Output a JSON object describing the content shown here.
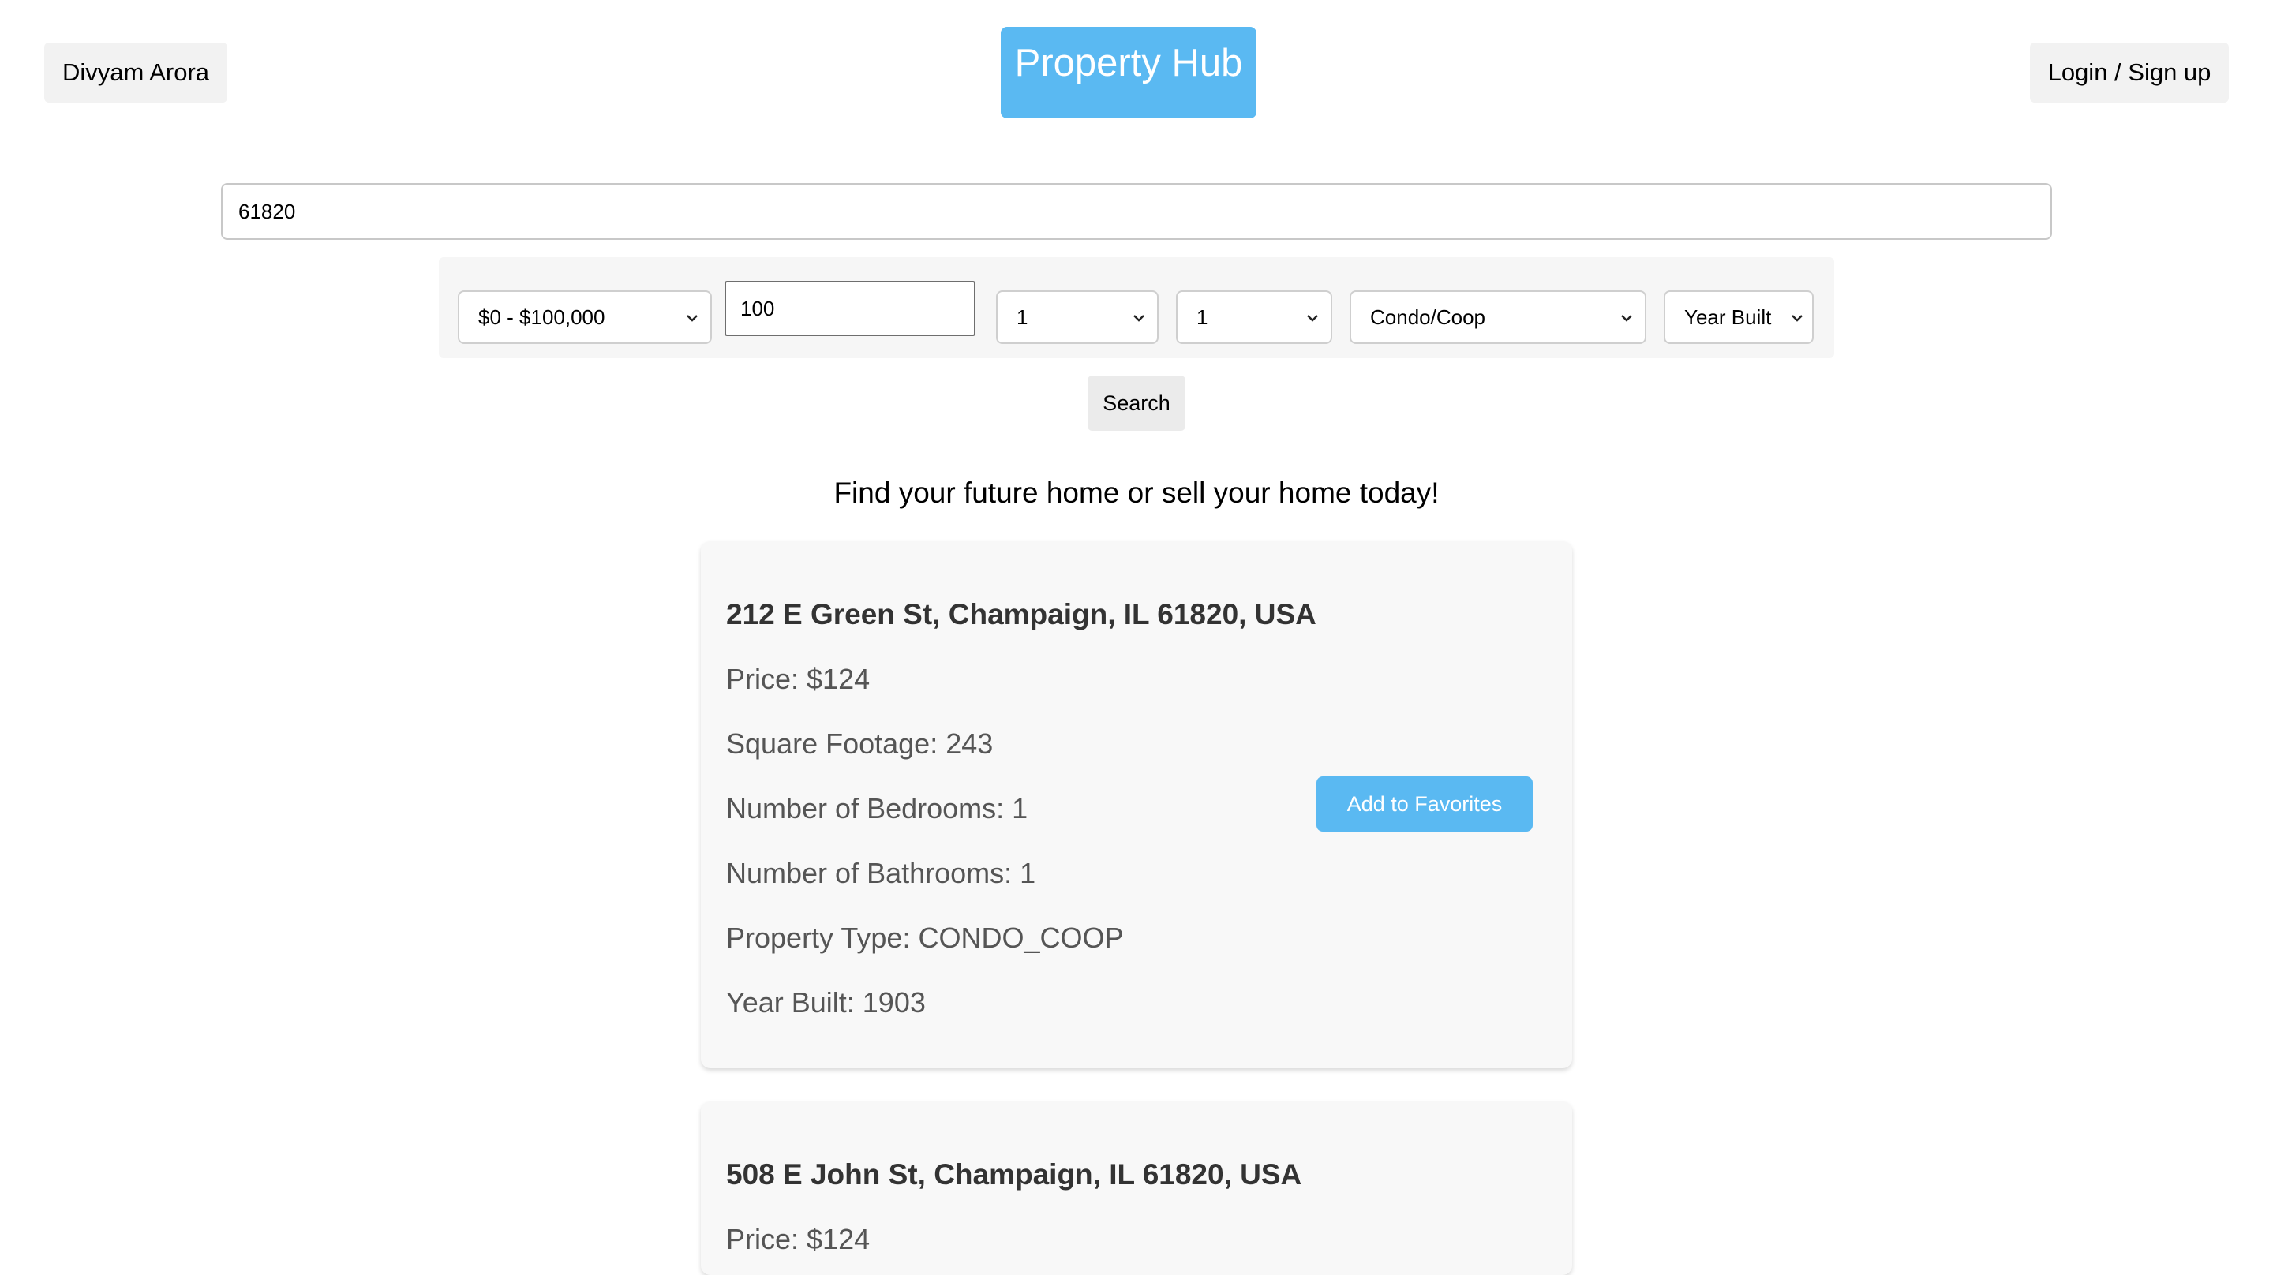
{
  "header": {
    "user_name": "Divyam Arora",
    "brand": "Property Hub",
    "login_label": "Login / Sign up"
  },
  "search": {
    "query": "61820"
  },
  "filters": {
    "price_range": "$0 - $100,000",
    "square_footage": "100",
    "bedrooms": "1",
    "bathrooms": "1",
    "property_type": "Condo/Coop",
    "year_built": "Year Built",
    "search_label": "Search"
  },
  "tagline": "Find your future home or sell your home today!",
  "listings": [
    {
      "address": "212 E Green St, Champaign, IL 61820, USA",
      "price": "Price: $124",
      "square_footage": "Square Footage: 243",
      "bedrooms": "Number of Bedrooms: 1",
      "bathrooms": "Number of Bathrooms: 1",
      "property_type": "Property Type: CONDO_COOP",
      "year_built": "Year Built: 1903",
      "favorite_label": "Add to Favorites"
    },
    {
      "address": "508 E John St, Champaign, IL 61820, USA",
      "price": "Price: $124"
    }
  ],
  "colors": {
    "accent": "#5ab9f2",
    "chip_bg": "#f2f2f2",
    "card_bg": "#f8f8f8"
  },
  "icons": {
    "dropdown": "chevron-down-icon"
  }
}
